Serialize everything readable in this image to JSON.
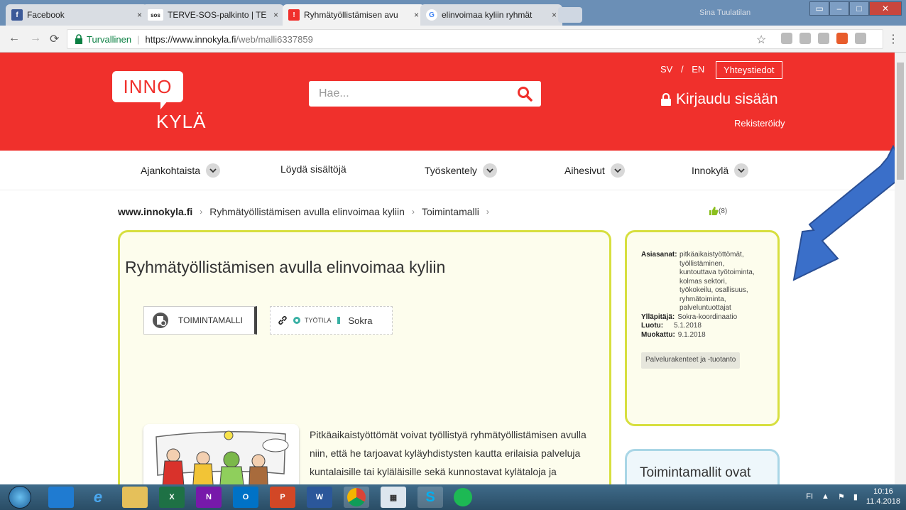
{
  "browser": {
    "tabs": [
      {
        "title": "Facebook",
        "favicon": "facebook-icon",
        "color": "#3b5998"
      },
      {
        "title": "TERVE-SOS-palkinto | TE",
        "favicon": "sos-icon",
        "color": "#222222",
        "badge": "sos"
      },
      {
        "title": "Ryhmätyöllistämisen avu",
        "favicon": "innokyla-icon",
        "color": "#f0302c"
      },
      {
        "title": "elinvoimaa kyliin ryhmät",
        "favicon": "google-icon",
        "color": "#4285f4",
        "badge": "G"
      }
    ],
    "close_glyph": "×",
    "window_user": "Sina Tuulatilan",
    "secure_label": "Turvallinen",
    "url_host": "https://www.innokyla.fi",
    "url_path": "/web/malli6337859"
  },
  "site": {
    "logo_top": "INNO",
    "logo_bottom": "KYLÄ",
    "search_placeholder": "Hae...",
    "lang_sv": "SV",
    "lang_sep": "/",
    "lang_en": "EN",
    "contact": "Yhteystiedot",
    "login": "Kirjaudu sisään",
    "register": "Rekisteröidy",
    "accent": "#f0302c"
  },
  "nav": [
    {
      "label": "Ajankohtaista",
      "dropdown": true
    },
    {
      "label": "Löydä sisältöjä",
      "dropdown": false
    },
    {
      "label": "Työskentely",
      "dropdown": true
    },
    {
      "label": "Aihesivut",
      "dropdown": true
    },
    {
      "label": "Innokylä",
      "dropdown": true
    }
  ],
  "breadcrumb": {
    "root": "www.innokyla.fi",
    "level1": "Ryhmätyöllistämisen avulla elinvoimaa kyliin",
    "level2": "Toimintamalli",
    "arrow": "›"
  },
  "likes": "(8)",
  "article": {
    "title": "Ryhmätyöllistämisen avulla elinvoimaa kyliin",
    "type_label": "TOIMINTAMALLI",
    "workspace_label": "TYÖTILA",
    "workspace_name": "Sokra",
    "description": "Pitkäaikaistyöttömät voivat työllistyä ryhmätyöllistämisen avulla niin, että he tarjoavat kyläyhdistysten kautta erilaisia palveluja kuntalaisille tai kyläläisille sekä kunnostavat kylätaloja ja ympäristöä. Tämä vahvistaa kylien elinvoimaa."
  },
  "sidebar": {
    "keywords_label": "Asiasanat:",
    "keywords": "pitkäaikaistyöttömät, työllistäminen, kuntouttava työtoiminta, kolmas sektori, työkokeilu, osallisuus, ryhmätoiminta, palveluntuottajat",
    "maintainer_label": "Ylläpitäjä:",
    "maintainer": "Sokra-koordinaatio",
    "created_label": "Luotu:",
    "created": "5.1.2018",
    "modified_label": "Muokattu:",
    "modified": "9.1.2018",
    "tag": "Palvelurakenteet ja -tuotanto"
  },
  "bluecard": {
    "title": "Toimintamallit ovat"
  },
  "taskbar": {
    "apps": [
      "media-player-icon",
      "internet-explorer-icon",
      "file-explorer-icon",
      "excel-icon",
      "onenote-icon",
      "outlook-icon",
      "powerpoint-icon",
      "word-icon",
      "chrome-icon",
      "calculator-icon",
      "skype-icon",
      "spotify-icon"
    ],
    "lang": "FI",
    "time": "10:16",
    "date": "11.4.2018"
  },
  "annotation_arrow_color": "#3a6fc9"
}
